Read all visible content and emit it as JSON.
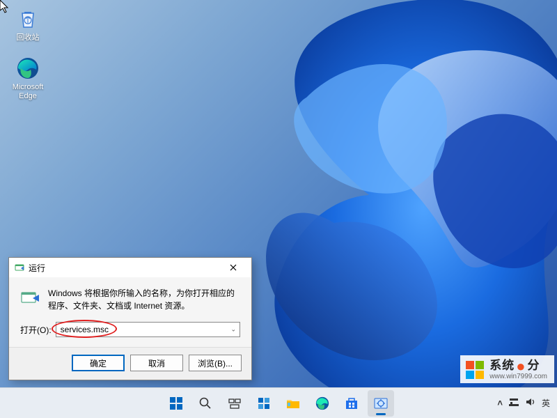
{
  "desktop": {
    "icons": [
      {
        "name": "recycle-bin",
        "label": "回收站"
      },
      {
        "name": "edge",
        "label": "Microsoft\nEdge"
      }
    ]
  },
  "run_dialog": {
    "title": "运行",
    "description": "Windows 将根据你所输入的名称，为你打开相应的程序、文件夹、文档或 Internet 资源。",
    "open_label": "打开(O):",
    "input_value": "services.msc",
    "buttons": {
      "ok": "确定",
      "cancel": "取消",
      "browse": "浏览(B)..."
    }
  },
  "taskbar": {
    "items": [
      {
        "name": "start",
        "active": false
      },
      {
        "name": "search",
        "active": false
      },
      {
        "name": "task-view",
        "active": false
      },
      {
        "name": "widgets",
        "active": false
      },
      {
        "name": "explorer",
        "active": false
      },
      {
        "name": "edge",
        "active": false
      },
      {
        "name": "store",
        "active": false
      },
      {
        "name": "services",
        "active": true
      }
    ],
    "tray": {
      "chevron": "^",
      "network": "network-icon",
      "volume": "volume-icon",
      "ime": "英"
    }
  },
  "watermark": {
    "brand_a": "系统",
    "brand_b": "分",
    "url": "www.win7999.com"
  }
}
